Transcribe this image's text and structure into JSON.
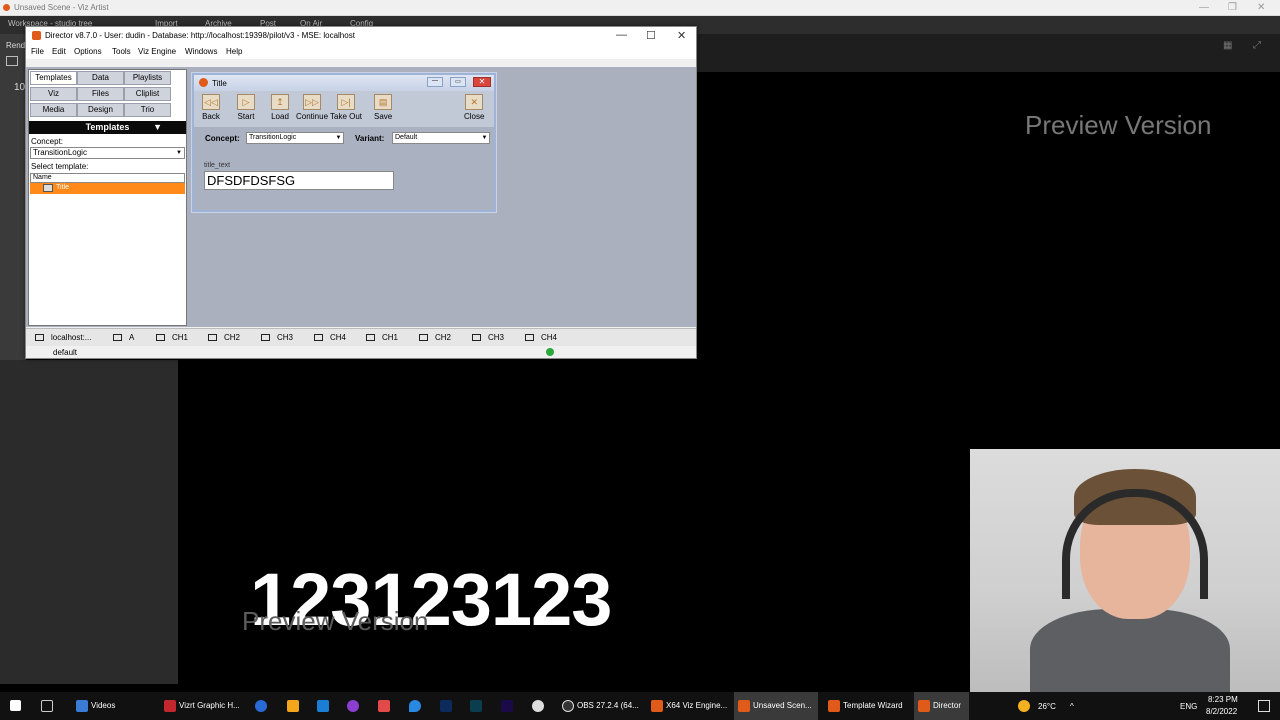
{
  "viz": {
    "title": "Unsaved Scene - Viz Artist",
    "menu_items": [
      "Workspace - studio tree",
      "Import",
      "Archive",
      "Post",
      "On Air",
      "Config"
    ],
    "left_label": "Rend",
    "number_label": "10"
  },
  "preview": {
    "top_text": "Preview Version",
    "bottom_text": "Preview Version",
    "big_number": "123123123"
  },
  "director": {
    "title": "Director v8.7.0  - User: dudin - Database: http://localhost:19398/pilot/v3 - MSE: localhost",
    "menu": [
      "File",
      "Edit",
      "Options",
      "Tools",
      "Viz Engine",
      "Windows",
      "Help"
    ],
    "tabs": [
      "Templates",
      "Data",
      "Playlists",
      "Viz",
      "Files",
      "Cliplist",
      "Media",
      "Design",
      "Trio"
    ],
    "templates_header": "Templates",
    "concept_label": "Concept:",
    "concept_value": "TransitionLogic",
    "select_template_label": "Select template:",
    "name_header": "Name",
    "template_item": "Title",
    "status_channels": [
      "localhost:...",
      "A",
      "CH1",
      "CH2",
      "CH3",
      "CH4",
      "CH1",
      "CH2",
      "CH3",
      "CH4"
    ],
    "profile": "default"
  },
  "title_dialog": {
    "title": "Title",
    "toolbar": [
      {
        "label": "Back",
        "icon": "rewind-icon"
      },
      {
        "label": "Start",
        "icon": "play-icon"
      },
      {
        "label": "Load",
        "icon": "load-icon"
      },
      {
        "label": "Continue",
        "icon": "continue-icon"
      },
      {
        "label": "Take Out",
        "icon": "take-out-icon"
      },
      {
        "label": "Save",
        "icon": "save-icon"
      },
      {
        "label": "Close",
        "icon": "close-icon"
      }
    ],
    "concept_label": "Concept:",
    "concept_value": "TransitionLogic",
    "variant_label": "Variant:",
    "variant_value": "Default",
    "field_label": "title_text",
    "field_value": "DFSDFDSFSG"
  },
  "taskbar": {
    "items": [
      "Videos",
      "Vizrt Graphic H...",
      "OBS 27.2.4 (64...",
      "X64 Viz Engine...",
      "Unsaved Scen...",
      "Template Wizard",
      "Director"
    ],
    "temperature": "26°C",
    "language": "ENG",
    "time": "8:23 PM",
    "date": "8/2/2022"
  }
}
